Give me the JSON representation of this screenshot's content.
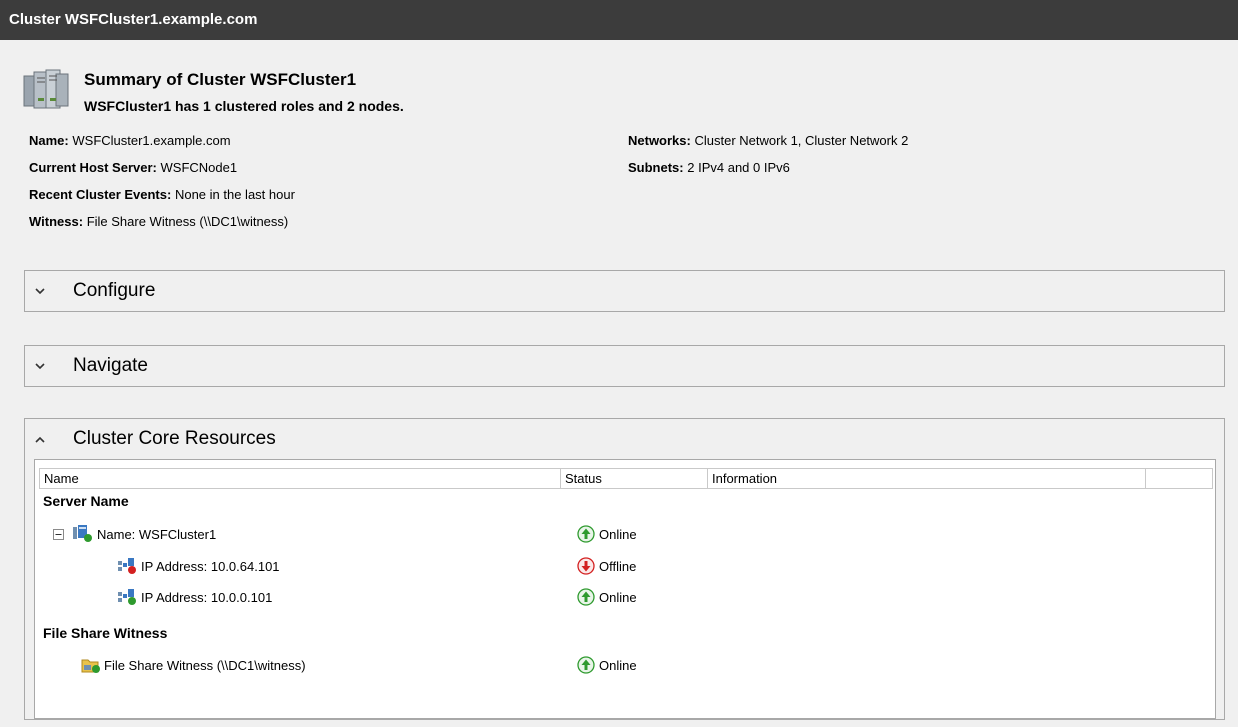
{
  "window": {
    "title": "Cluster WSFCluster1.example.com"
  },
  "summary": {
    "title": "Summary of Cluster WSFCluster1",
    "subtitle": "WSFCluster1 has 1 clustered roles and 2 nodes."
  },
  "details": {
    "name": {
      "label": "Name:",
      "value": "WSFCluster1.example.com"
    },
    "current_host": {
      "label": "Current Host Server:",
      "value": "WSFCNode1"
    },
    "recent_events": {
      "label": "Recent Cluster Events:",
      "value": "None in the last hour"
    },
    "witness": {
      "label": "Witness:",
      "value": "File Share Witness (\\\\DC1\\witness)"
    },
    "networks": {
      "label": "Networks:",
      "value": "Cluster Network 1, Cluster Network 2"
    },
    "subnets": {
      "label": "Subnets:",
      "value": "2 IPv4 and 0 IPv6"
    }
  },
  "sections": {
    "configure": {
      "label": "Configure",
      "expanded": false
    },
    "navigate": {
      "label": "Navigate",
      "expanded": false
    },
    "core_resources": {
      "label": "Cluster Core Resources",
      "expanded": true
    }
  },
  "resources": {
    "columns": [
      "Name",
      "Status",
      "Information"
    ],
    "groups": [
      {
        "label": "Server Name"
      },
      {
        "label": "File Share Witness"
      }
    ],
    "rows": [
      {
        "name": "Name: WSFCluster1",
        "status": "Online",
        "icon": "network-name-icon"
      },
      {
        "name": "IP Address: 10.0.64.101",
        "status": "Offline",
        "icon": "ip-address-icon"
      },
      {
        "name": "IP Address: 10.0.0.101",
        "status": "Online",
        "icon": "ip-address-icon"
      },
      {
        "name": "File Share Witness (\\\\DC1\\witness)",
        "status": "Online",
        "icon": "file-share-witness-icon"
      }
    ]
  },
  "colors": {
    "online": "#2e9a2e",
    "offline": "#d32020",
    "titlebar": "#3c3c3c"
  }
}
